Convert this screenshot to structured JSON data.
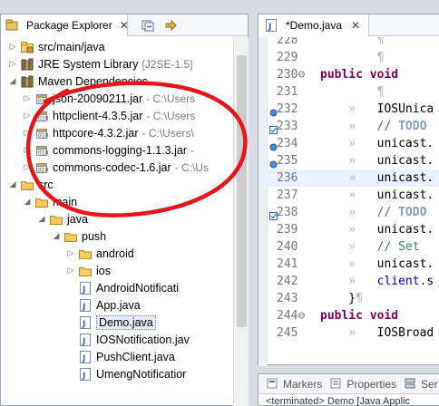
{
  "package_explorer": {
    "title": "Package Explorer",
    "close": "✕",
    "tools": [
      "collapse-all-icon",
      "link-with-editor-icon"
    ],
    "items": [
      {
        "label": "src/main/java",
        "decoration": "",
        "icon": "package-folder-icon",
        "arrow": "▷"
      },
      {
        "label": "JRE System Library",
        "decoration": "[J2SE-1.5]",
        "icon": "library-icon",
        "arrow": "▷"
      },
      {
        "label": "Maven Dependencies",
        "decoration": "",
        "icon": "library-icon",
        "arrow": "◢"
      },
      {
        "label": "json-20090211.jar",
        "decoration": "- C:\\Users",
        "icon": "jar-icon",
        "arrow": "▷"
      },
      {
        "label": "httpclient-4.3.5.jar",
        "decoration": "- C:\\Users",
        "icon": "jar-icon",
        "arrow": "▷"
      },
      {
        "label": "httpcore-4.3.2.jar",
        "decoration": "- C:\\Users\\",
        "icon": "jar-icon",
        "arrow": "▷"
      },
      {
        "label": "commons-logging-1.1.3.jar",
        "decoration": "-",
        "icon": "jar-icon",
        "arrow": "▷"
      },
      {
        "label": "commons-codec-1.6.jar",
        "decoration": "- C:\\Us",
        "icon": "jar-icon",
        "arrow": "▷"
      },
      {
        "label": "src",
        "decoration": "",
        "icon": "folder-icon",
        "arrow": "◢"
      },
      {
        "label": "main",
        "decoration": "",
        "icon": "folder-icon",
        "arrow": "◢"
      },
      {
        "label": "java",
        "decoration": "",
        "icon": "folder-icon",
        "arrow": "◢"
      },
      {
        "label": "push",
        "decoration": "",
        "icon": "folder-icon",
        "arrow": "◢"
      },
      {
        "label": "android",
        "decoration": "",
        "icon": "folder-icon",
        "arrow": "▷"
      },
      {
        "label": "ios",
        "decoration": "",
        "icon": "folder-icon",
        "arrow": "▷"
      },
      {
        "label": "AndroidNotificati",
        "decoration": "",
        "icon": "java-file-icon",
        "arrow": ""
      },
      {
        "label": "App.java",
        "decoration": "",
        "icon": "java-file-icon",
        "arrow": ""
      },
      {
        "label": "Demo.java",
        "decoration": "",
        "icon": "java-file-icon",
        "arrow": ""
      },
      {
        "label": "IOSNotification.jav",
        "decoration": "",
        "icon": "java-file-icon",
        "arrow": ""
      },
      {
        "label": "PushClient.java",
        "decoration": "",
        "icon": "java-file-icon",
        "arrow": ""
      },
      {
        "label": "UmengNotificatior",
        "decoration": "",
        "icon": "java-file-icon",
        "arrow": ""
      }
    ]
  },
  "editor": {
    "tab_title": "*Demo.java",
    "close": "✕",
    "lines": [
      {
        "num": "228",
        "marker": "",
        "text": "        ¶"
      },
      {
        "num": "229",
        "marker": "",
        "text": "        ¶"
      },
      {
        "num": "230⊖",
        "marker": "",
        "text": "public void "
      },
      {
        "num": "231",
        "marker": "",
        "text": "        ¶"
      },
      {
        "num": "232",
        "marker": "info",
        "text": "    »   IOSUnica"
      },
      {
        "num": "233",
        "marker": "task",
        "text": "    »   // TODO "
      },
      {
        "num": "234",
        "marker": "info",
        "text": "    »   unicast."
      },
      {
        "num": "235",
        "marker": "info",
        "text": "    »   unicast."
      },
      {
        "num": "236",
        "marker": "",
        "text": "    »   unicast."
      },
      {
        "num": "237",
        "marker": "",
        "text": "    »   unicast."
      },
      {
        "num": "238",
        "marker": "task",
        "text": "    »   // TODO "
      },
      {
        "num": "239",
        "marker": "",
        "text": "    »   unicast."
      },
      {
        "num": "240",
        "marker": "",
        "text": "    »   // Set "
      },
      {
        "num": "241",
        "marker": "",
        "text": "    »   unicast."
      },
      {
        "num": "242",
        "marker": "",
        "text": "    »   client.s"
      },
      {
        "num": "243",
        "marker": "",
        "text": "    }¶"
      },
      {
        "num": "244⊖",
        "marker": "",
        "text": "public void "
      },
      {
        "num": "245",
        "marker": "",
        "text": "    »   IOSBroad"
      }
    ]
  },
  "bottom_panel": {
    "tabs": [
      {
        "label": "Markers",
        "icon": "markers-icon"
      },
      {
        "label": "Properties",
        "icon": "properties-icon"
      },
      {
        "label": "Ser",
        "icon": "servers-icon"
      }
    ],
    "console": "<terminated> Demo [Java Applic"
  },
  "colors": {
    "annotation": "#e8141c",
    "keyword": "#7f0055",
    "comment": "#3f7f5f",
    "task_tag": "#7f9fbf"
  }
}
